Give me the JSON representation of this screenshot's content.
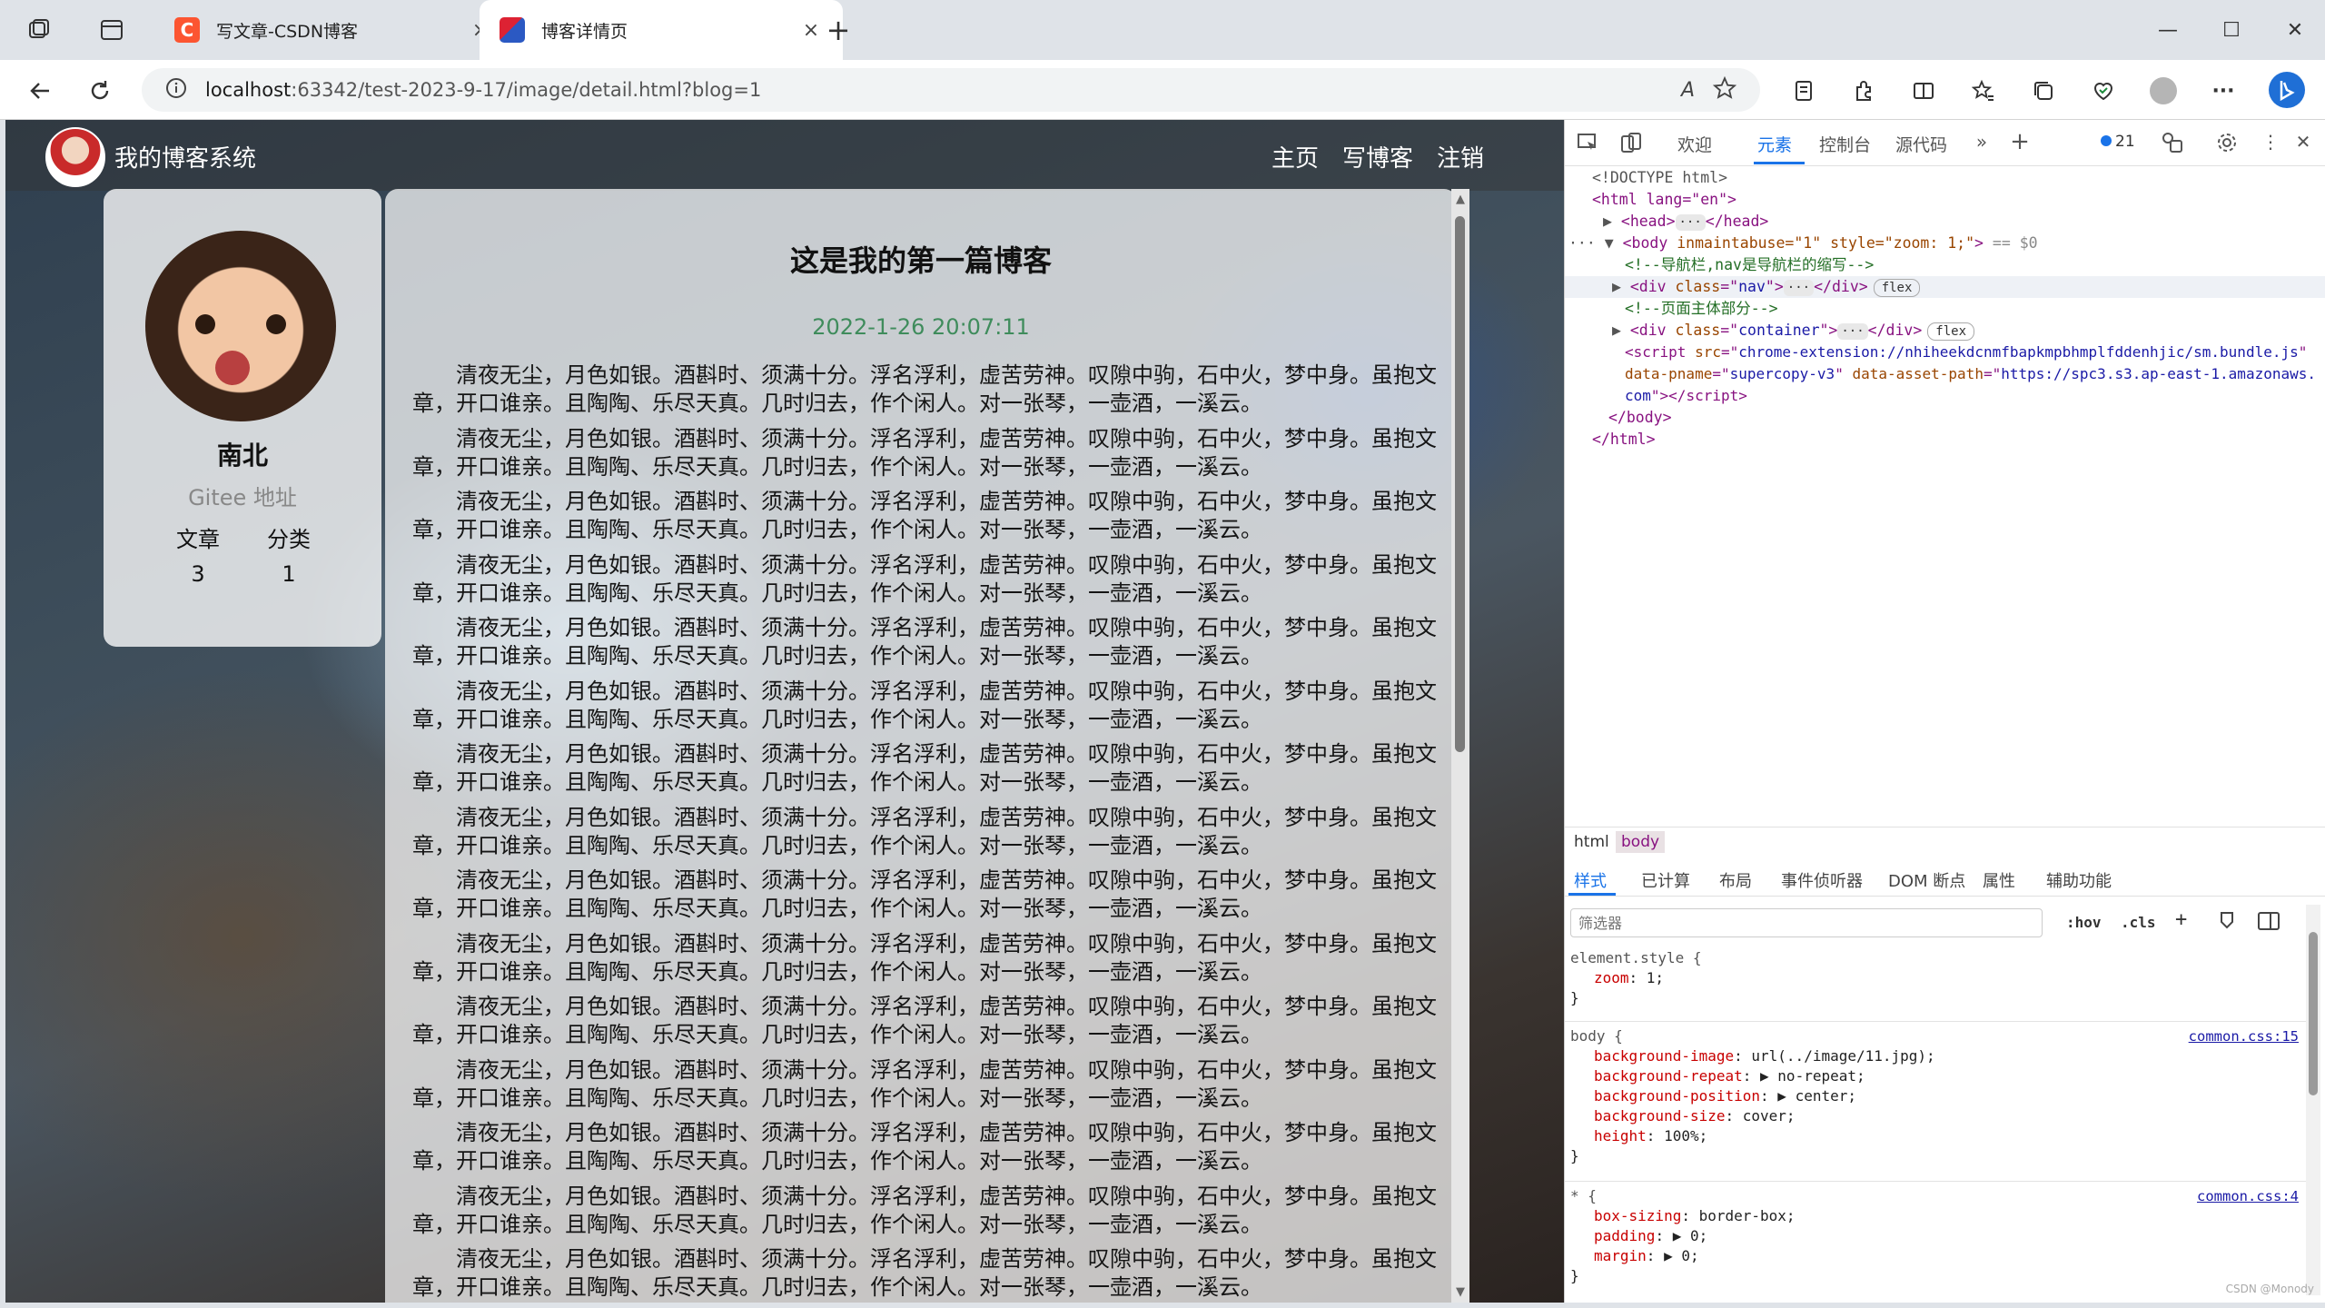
{
  "browser": {
    "tabs": [
      {
        "title": "写文章-CSDN博客",
        "favicon_color": "#fc5531",
        "favicon_glyph": "C",
        "active": false
      },
      {
        "title": "博客详情页",
        "favicon_color": "#2b59c3",
        "favicon_glyph": "",
        "active": true
      }
    ],
    "new_tab_symbol": "+",
    "close_symbol": "×",
    "window_controls": {
      "minimize": "—",
      "maximize": "☐",
      "close": "✕"
    },
    "url_host": "localhost",
    "url_path": ":63342/test-2023-9-17/image/detail.html?blog=1",
    "read_aloud_glyph": "A",
    "more_glyph": "···"
  },
  "site": {
    "nav": {
      "brand": "我的博客系统",
      "links": [
        "主页",
        "写博客",
        "注销"
      ]
    },
    "profile": {
      "name": "南北",
      "gitee": "Gitee 地址",
      "stats": [
        {
          "label": "文章",
          "value": "3"
        },
        {
          "label": "分类",
          "value": "1"
        }
      ]
    },
    "article": {
      "title": "这是我的第一篇博客",
      "date": "2022-1-26 20:07:11",
      "paragraph": "清夜无尘，月色如银。酒斟时、须满十分。浮名浮利，虚苦劳神。叹隙中驹，石中火，梦中身。虽抱文章，开口谁亲。且陶陶、乐尽天真。几时归去，作个闲人。对一张琴，一壶酒，一溪云。",
      "paragraph_count": 15
    }
  },
  "devtools": {
    "tabs": [
      "欢迎",
      "元素",
      "控制台",
      "源代码"
    ],
    "active_tab": "元素",
    "issues_count": "21",
    "dom": {
      "doctype": "<!DOCTYPE html>",
      "html_open": "<html lang=\"en\">",
      "head": "head",
      "body_attrs": "inmaintabuse=\"1\" style=\"zoom: 1;\"",
      "body_marker": "== $0",
      "comment_nav": "<!--导航栏,nav是导航栏的缩写-->",
      "div_nav_class": "nav",
      "comment_main": "<!--页面主体部分-->",
      "div_container_class": "container",
      "flex_badge": "flex",
      "script_src": "chrome-extension://nhiheekdcnmfbapkmpbhmplfddenhjic/sm.bundle.js",
      "script_pname": "supercopy-v3",
      "script_asset": "https://spc3.s3.ap-east-1.amazonaws.com",
      "body_close": "</body>",
      "html_close": "</html>"
    },
    "breadcrumbs": [
      "html",
      "body"
    ],
    "styles_tabs": [
      "样式",
      "已计算",
      "布局",
      "事件侦听器",
      "DOM 断点",
      "属性",
      "辅助功能"
    ],
    "filter_placeholder": "筛选器",
    "filter_buttons": [
      ":hov",
      ".cls",
      "+"
    ],
    "rules": {
      "element_style": {
        "selector": "element.style {",
        "props": [
          [
            "zoom",
            "1;"
          ]
        ]
      },
      "body": {
        "selector": "body {",
        "source": "common.css:15",
        "props": [
          [
            "background-image",
            "url(../image/11.jpg);"
          ],
          [
            "background-repeat",
            "▶ no-repeat;"
          ],
          [
            "background-position",
            "▶ center;"
          ],
          [
            "background-size",
            "cover;"
          ],
          [
            "height",
            "100%;"
          ]
        ]
      },
      "star": {
        "selector": "* {",
        "source": "common.css:4",
        "props": [
          [
            "box-sizing",
            "border-box;"
          ],
          [
            "padding",
            "▶ 0;"
          ],
          [
            "margin",
            "▶ 0;"
          ]
        ]
      },
      "close_brace": "}"
    },
    "watermark": "CSDN @Monody"
  }
}
